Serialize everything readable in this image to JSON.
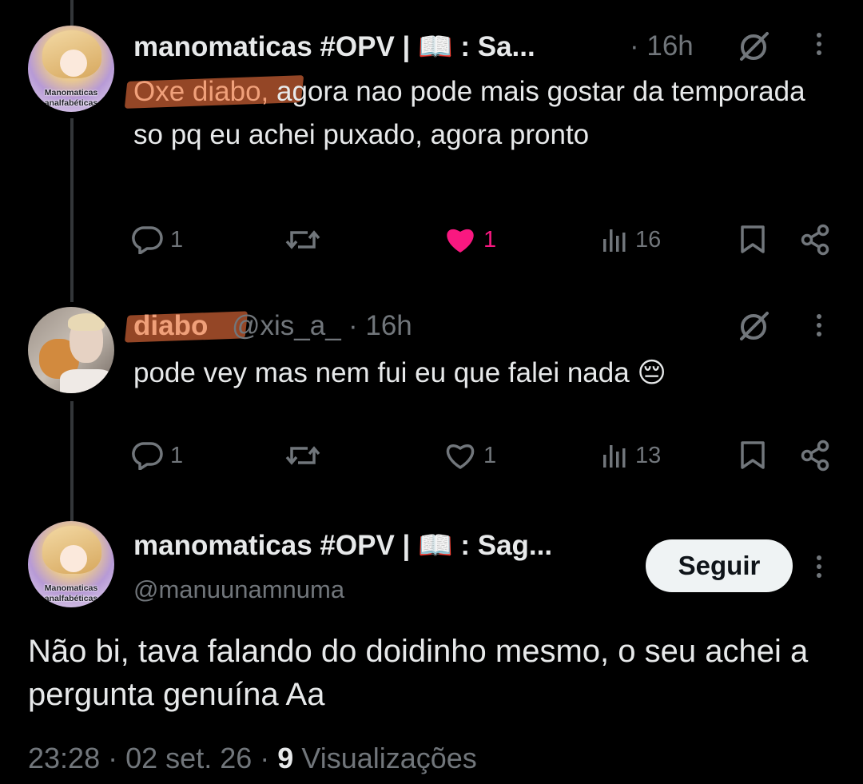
{
  "tweets": [
    {
      "author_name": "manomaticas #OPV | 📖 : Sa...",
      "timestamp": "· 16h",
      "avatar_text": [
        "Manomaticas",
        "analfabéticas"
      ],
      "highlight": "Oxe diabo,",
      "text": " agora nao pode mais gostar da temporada so pq eu achei puxado, agora pronto",
      "replies": "1",
      "retweets": "",
      "likes": "1",
      "liked": true,
      "views": "16"
    },
    {
      "author_name": "diabo",
      "handle": "@xis_a_",
      "timestamp": "· 16h",
      "text": "pode vey mas nem fui eu que falei nada 😔",
      "replies": "1",
      "retweets": "",
      "likes": "1",
      "liked": false,
      "views": "13"
    }
  ],
  "main_tweet": {
    "author_name": "manomaticas #OPV | 📖 : Sag...",
    "handle": "@manuunamnuma",
    "avatar_text": [
      "Manomaticas",
      "analfabéticas"
    ],
    "follow_label": "Seguir",
    "text": "Não bi, tava falando do doidinho mesmo, o seu achei a pergunta genuína Aa",
    "time": "23:28",
    "date": "02 set. 26",
    "views_count": "9",
    "views_label": "Visualizações",
    "sep": "·"
  },
  "colors": {
    "background": "#000000",
    "text": "#e7e9ea",
    "muted": "#71767b",
    "like": "#f91880",
    "highlight": "#9c4a28"
  }
}
